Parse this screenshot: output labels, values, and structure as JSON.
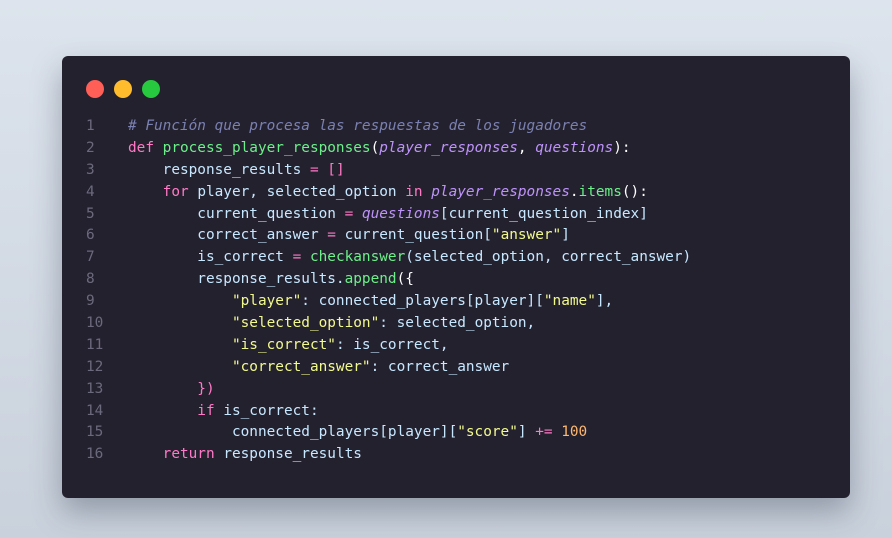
{
  "window": {
    "traffic_lights": [
      {
        "name": "close",
        "color": "#ff5f56"
      },
      {
        "name": "minimize",
        "color": "#ffbd2e"
      },
      {
        "name": "maximize",
        "color": "#27c93f"
      }
    ]
  },
  "code": {
    "lines": [
      {
        "n": "1",
        "tokens": [
          {
            "t": "# Función que procesa las respuestas de los jugadores",
            "c": "cm"
          }
        ]
      },
      {
        "n": "2",
        "tokens": [
          {
            "t": "def ",
            "c": "kw"
          },
          {
            "t": "process_player_responses",
            "c": "fn"
          },
          {
            "t": "(",
            "c": "op"
          },
          {
            "t": "player_responses",
            "c": "param"
          },
          {
            "t": ", ",
            "c": "op"
          },
          {
            "t": "questions",
            "c": "param"
          },
          {
            "t": "):",
            "c": "op"
          }
        ]
      },
      {
        "n": "3",
        "tokens": [
          {
            "t": "    response_results ",
            "c": "var"
          },
          {
            "t": "= ",
            "c": "kw"
          },
          {
            "t": "[]",
            "c": "kw"
          }
        ]
      },
      {
        "n": "4",
        "tokens": [
          {
            "t": "    for ",
            "c": "kw"
          },
          {
            "t": "player, selected_option ",
            "c": "var"
          },
          {
            "t": "in ",
            "c": "kw"
          },
          {
            "t": "player_responses",
            "c": "param"
          },
          {
            "t": ".",
            "c": "op"
          },
          {
            "t": "items",
            "c": "fn"
          },
          {
            "t": "():",
            "c": "op"
          }
        ]
      },
      {
        "n": "5",
        "tokens": [
          {
            "t": "        current_question ",
            "c": "var"
          },
          {
            "t": "= ",
            "c": "kw"
          },
          {
            "t": "questions",
            "c": "param"
          },
          {
            "t": "[current_question_index]",
            "c": "var"
          }
        ]
      },
      {
        "n": "6",
        "tokens": [
          {
            "t": "        correct_answer ",
            "c": "var"
          },
          {
            "t": "= ",
            "c": "kw"
          },
          {
            "t": "current_question[",
            "c": "var"
          },
          {
            "t": "\"answer\"",
            "c": "str"
          },
          {
            "t": "]",
            "c": "var"
          }
        ]
      },
      {
        "n": "7",
        "tokens": [
          {
            "t": "        is_correct ",
            "c": "var"
          },
          {
            "t": "= ",
            "c": "kw"
          },
          {
            "t": "checkanswer",
            "c": "fn"
          },
          {
            "t": "(selected_option, correct_answer)",
            "c": "var"
          }
        ]
      },
      {
        "n": "8",
        "tokens": [
          {
            "t": "        response_results.",
            "c": "var"
          },
          {
            "t": "append",
            "c": "fn"
          },
          {
            "t": "({",
            "c": "op"
          }
        ]
      },
      {
        "n": "9",
        "tokens": [
          {
            "t": "            ",
            "c": "var"
          },
          {
            "t": "\"player\"",
            "c": "str"
          },
          {
            "t": ": connected_players[player][",
            "c": "var"
          },
          {
            "t": "\"name\"",
            "c": "str"
          },
          {
            "t": "],",
            "c": "var"
          }
        ]
      },
      {
        "n": "10",
        "tokens": [
          {
            "t": "            ",
            "c": "var"
          },
          {
            "t": "\"selected_option\"",
            "c": "str"
          },
          {
            "t": ": selected_option,",
            "c": "var"
          }
        ]
      },
      {
        "n": "11",
        "tokens": [
          {
            "t": "            ",
            "c": "var"
          },
          {
            "t": "\"is_correct\"",
            "c": "str"
          },
          {
            "t": ": is_correct,",
            "c": "var"
          }
        ]
      },
      {
        "n": "12",
        "tokens": [
          {
            "t": "            ",
            "c": "var"
          },
          {
            "t": "\"correct_answer\"",
            "c": "str"
          },
          {
            "t": ": correct_answer",
            "c": "var"
          }
        ]
      },
      {
        "n": "13",
        "tokens": [
          {
            "t": "        })",
            "c": "kw"
          }
        ]
      },
      {
        "n": "14",
        "tokens": [
          {
            "t": "        if ",
            "c": "kw"
          },
          {
            "t": "is_correct:",
            "c": "var"
          }
        ]
      },
      {
        "n": "15",
        "tokens": [
          {
            "t": "            connected_players[player][",
            "c": "var"
          },
          {
            "t": "\"score\"",
            "c": "str"
          },
          {
            "t": "] ",
            "c": "var"
          },
          {
            "t": "+= ",
            "c": "kw"
          },
          {
            "t": "100",
            "c": "num"
          }
        ]
      },
      {
        "n": "16",
        "tokens": [
          {
            "t": "    return ",
            "c": "kw"
          },
          {
            "t": "response_results",
            "c": "var"
          }
        ]
      }
    ]
  }
}
